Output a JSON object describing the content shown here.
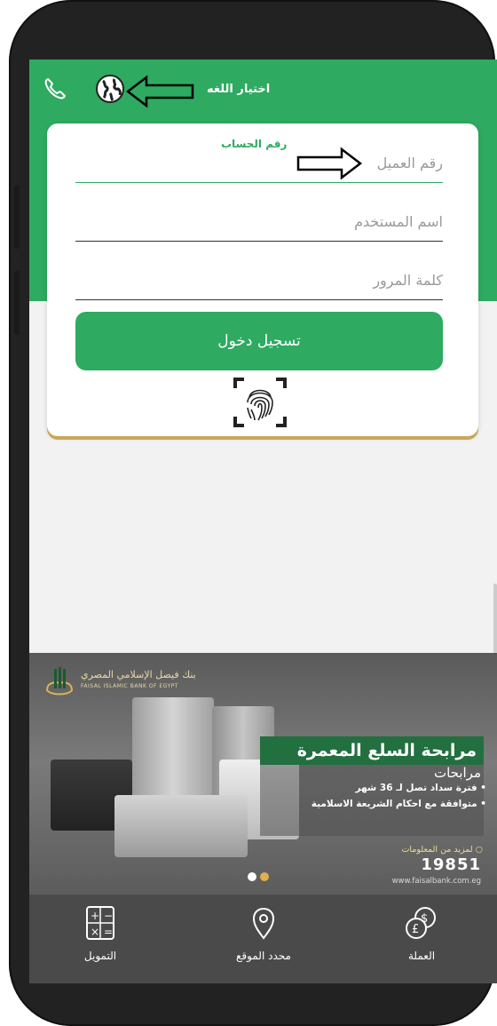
{
  "header": {
    "language_label": "اختيار اللغه",
    "icons": [
      "phone-icon",
      "globe-icon",
      "arrow-left-icon"
    ]
  },
  "login_form": {
    "account_field": {
      "floating_label": "رقم الحساب",
      "placeholder": "رقم العميل"
    },
    "username_field": {
      "placeholder": "اسم المستخدم"
    },
    "password_field": {
      "placeholder": "كلمة المرور"
    },
    "login_button": "تسجيل دخول",
    "fingerprint_icon": "fingerprint-icon"
  },
  "banner": {
    "bank_name_ar": "بنك فيصل الإسلامي المصري",
    "bank_name_en": "FAISAL ISLAMIC BANK OF EGYPT",
    "title": "مرابحة السلع المعمرة",
    "subtitle": "مرابحات",
    "line1": "• فترة سداد تصل لـ 36 شهر",
    "line2": "• متوافقة مع احكام الشريعة الاسلامية",
    "more_info": "○ لمزيد من المعلومات",
    "hotline": "19851",
    "website": "www.faisalbank.com.eg",
    "carousel_dots": 2,
    "carousel_active": 1
  },
  "bottom_nav": {
    "items": [
      {
        "label": "التمويل",
        "icon": "calculator-icon"
      },
      {
        "label": "محدد الموقع",
        "icon": "location-pin-icon"
      },
      {
        "label": "العملة",
        "icon": "currency-exchange-icon"
      }
    ]
  },
  "colors": {
    "primary_green": "#2eaa61",
    "gold_accent": "#c8a85a",
    "nav_bg": "#4a4a4a"
  }
}
